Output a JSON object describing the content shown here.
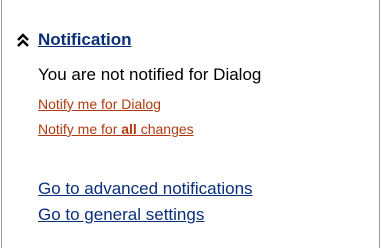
{
  "notification": {
    "title": "Notification",
    "status": "You are not notified for Dialog",
    "notify_dialog": "Notify me for Dialog",
    "notify_all_prefix": "Notify me for ",
    "notify_all_bold": "all",
    "notify_all_suffix": " changes",
    "advanced_link": "Go to advanced notifications",
    "general_link": "Go to general settings"
  },
  "icons": {
    "collapse": "double-chevron-up-icon"
  },
  "colors": {
    "title_blue": "#0a2f7a",
    "link_red": "#b03a12"
  }
}
